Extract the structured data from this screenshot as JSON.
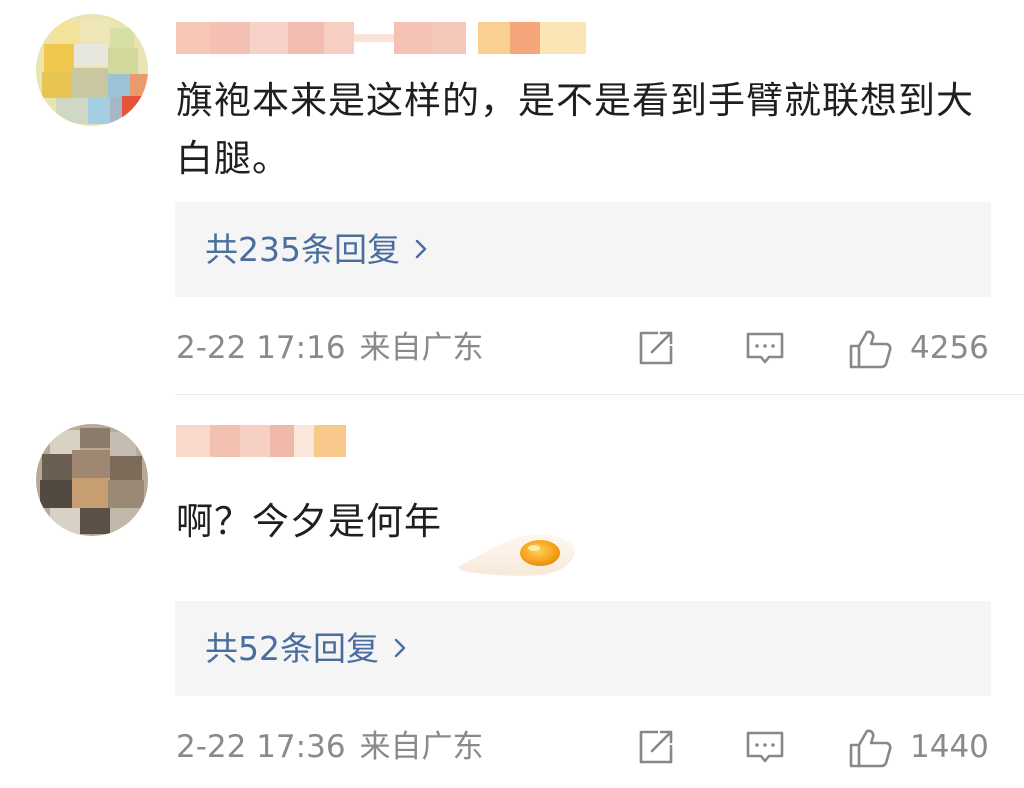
{
  "comments": [
    {
      "text": "旗袍本来是这样的，是不是看到手臂就联想到大白腿。",
      "reply_summary": "共235条回复",
      "time": "2-22 17:16",
      "location": "来自广东",
      "like_count": "4256",
      "icons": [
        "share-icon",
        "comment-icon",
        "like-icon",
        "chevron-right-icon"
      ],
      "sticker": null
    },
    {
      "text": "啊？今夕是何年",
      "reply_summary": "共52条回复",
      "time": "2-22 17:36",
      "location": "来自广东",
      "like_count": "1440",
      "icons": [
        "share-icon",
        "comment-icon",
        "like-icon",
        "chevron-right-icon"
      ],
      "sticker": "fried-egg-sticker"
    }
  ],
  "colors": {
    "reply_link": "#4a6d9e",
    "meta_text": "#8a8a8a",
    "body_text": "#1f1f1f",
    "reply_bg": "#f5f5f5"
  }
}
